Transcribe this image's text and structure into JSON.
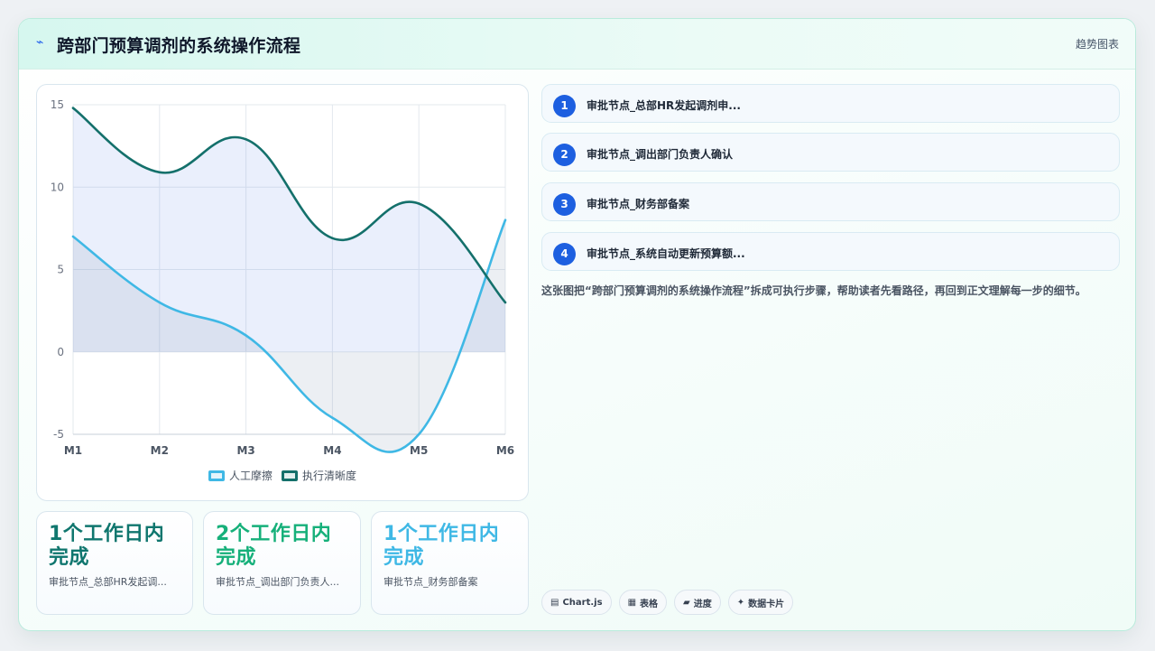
{
  "header": {
    "icon": "zap-icon",
    "title": "跨部门预算调剂的系统操作流程",
    "tag": "趋势图表"
  },
  "chart_data": {
    "type": "area",
    "categories": [
      "M1",
      "M2",
      "M3",
      "M4",
      "M5",
      "M6"
    ],
    "y_ticks": [
      "15",
      "10",
      "5",
      "0",
      "-5"
    ],
    "ylim": [
      -5,
      15
    ],
    "grid": true,
    "legend_position": "bottom",
    "series": [
      {
        "name": "人工摩擦",
        "values": [
          7,
          3,
          1,
          -4,
          -5,
          8
        ],
        "color": "#3fb8e5"
      },
      {
        "name": "执行清晰度",
        "values": [
          14.8,
          10.9,
          12.9,
          6.9,
          9,
          3
        ],
        "color": "#14706b"
      }
    ]
  },
  "stats": [
    {
      "value": "1个工作日内完成",
      "label": "审批节点_总部HR发起调...",
      "color": "#0f766e"
    },
    {
      "value": "2个工作日内完成",
      "label": "审批节点_调出部门负责人...",
      "color": "#16b07a"
    },
    {
      "value": "1个工作日内完成",
      "label": "审批节点_财务部备案",
      "color": "#3fb8e5"
    }
  ],
  "steps": [
    {
      "num": "1",
      "label": "审批节点_总部HR发起调剂申..."
    },
    {
      "num": "2",
      "label": "审批节点_调出部门负责人确认"
    },
    {
      "num": "3",
      "label": "审批节点_财务部备案"
    },
    {
      "num": "4",
      "label": "审批节点_系统自动更新预算额..."
    }
  ],
  "description": "这张图把“跨部门预算调剂的系统操作流程”拆成可执行步骤，帮助读者先看路径，再回到正文理解每一步的细节。",
  "chips": [
    {
      "icon": "table-icon",
      "glyph": "▤",
      "label": "Chart.js"
    },
    {
      "icon": "grid-icon",
      "glyph": "▦",
      "label": "表格"
    },
    {
      "icon": "progress-icon",
      "glyph": "▰",
      "label": "进度"
    },
    {
      "icon": "sparkle-icon",
      "glyph": "✦",
      "label": "数据卡片"
    }
  ]
}
